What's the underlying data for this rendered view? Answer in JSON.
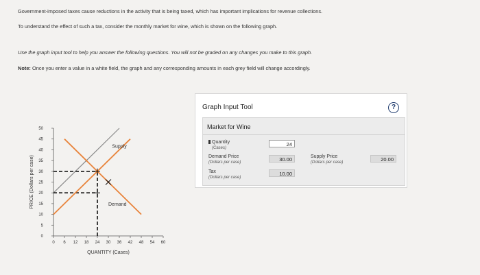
{
  "intro": {
    "line1": "Government-imposed taxes cause reductions in the activity that is being taxed, which has important implications for revenue collections.",
    "line2": "To understand the effect of such a tax, consider the monthly market for wine, which is shown on the following graph."
  },
  "instructions": {
    "line1": "Use the graph input tool to help you answer the following questions. You will not be graded on any changes you make to this graph.",
    "note_label": "Note:",
    "note_text": "Once you enter a value in a white field, the graph and any corresponding amounts in each grey field will change accordingly."
  },
  "chart_data": {
    "type": "line",
    "xlabel": "QUANTITY (Cases)",
    "ylabel": "PRICE (Dollars per case)",
    "xlim": [
      0,
      60
    ],
    "ylim": [
      0,
      50
    ],
    "x_ticks": [
      0,
      6,
      12,
      18,
      24,
      30,
      36,
      42,
      48,
      54,
      60
    ],
    "y_ticks": [
      0,
      5,
      10,
      15,
      20,
      25,
      30,
      35,
      40,
      45,
      50
    ],
    "series": [
      {
        "name": "Supply",
        "points": [
          [
            0,
            10
          ],
          [
            42,
            45
          ]
        ],
        "color": "#e8833a"
      },
      {
        "name": "Demand",
        "points": [
          [
            6,
            45
          ],
          [
            48,
            10
          ]
        ],
        "color": "#e8833a"
      }
    ],
    "guides": [
      {
        "y": 30,
        "x_from": 0,
        "x_to": 24,
        "style": "dashed"
      },
      {
        "y": 20,
        "x_from": 0,
        "x_to": 24,
        "style": "dashed"
      },
      {
        "x": 24,
        "y_from": 0,
        "y_to": 30,
        "style": "dashed"
      }
    ],
    "markers": [
      {
        "x": 24,
        "y": 30,
        "shape": "plus"
      },
      {
        "x": 24,
        "y": 20,
        "shape": "plus"
      },
      {
        "x": 30,
        "y": 25,
        "shape": "x"
      }
    ],
    "gray_line": {
      "points": [
        [
          0,
          20
        ],
        [
          36,
          50
        ]
      ],
      "color": "#8a8a8a"
    },
    "grid": false
  },
  "tool": {
    "title": "Graph Input Tool",
    "help_icon": "?",
    "market_title": "Market for Wine",
    "quantity_label": "Quantity",
    "quantity_unit": "(Cases)",
    "quantity_value": "24",
    "demand_price_label": "Demand Price",
    "demand_price_unit": "(Dollars per case)",
    "demand_price_value": "30.00",
    "tax_label": "Tax",
    "tax_unit": "(Dollars per case)",
    "tax_value": "10.00",
    "supply_price_label": "Supply Price",
    "supply_price_unit": "(Dollars per case)",
    "supply_price_value": "20.00"
  }
}
